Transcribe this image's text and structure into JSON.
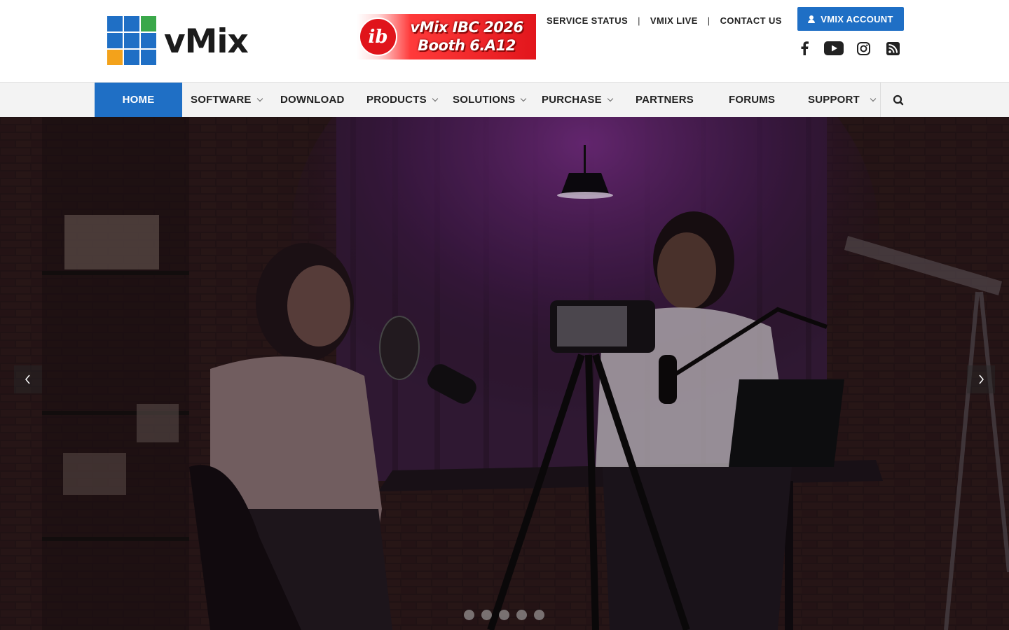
{
  "brand": {
    "name": "vMix",
    "logo_colors": [
      "#1f6fc5",
      "#1f6fc5",
      "#3aa84a",
      "#1f6fc5",
      "#1f6fc5",
      "#1f6fc5",
      "#f3a21b",
      "#1f6fc5",
      "#1f6fc5"
    ]
  },
  "promo": {
    "badge_icon": "ibc-logo",
    "line1": "vMix IBC 2026",
    "line2": "Booth 6.A12"
  },
  "top_links": [
    {
      "label": "SERVICE STATUS"
    },
    {
      "label": "VMIX LIVE"
    },
    {
      "label": "CONTACT US"
    }
  ],
  "top_link_separator": "|",
  "account_button": {
    "label": "VMIX ACCOUNT",
    "icon": "user-icon"
  },
  "social": [
    {
      "name": "facebook-icon"
    },
    {
      "name": "youtube-icon"
    },
    {
      "name": "instagram-icon"
    },
    {
      "name": "rss-icon"
    }
  ],
  "nav": {
    "items": [
      {
        "label": "HOME",
        "active": true,
        "dropdown": false
      },
      {
        "label": "SOFTWARE",
        "active": false,
        "dropdown": true
      },
      {
        "label": "DOWNLOAD",
        "active": false,
        "dropdown": false
      },
      {
        "label": "PRODUCTS",
        "active": false,
        "dropdown": true
      },
      {
        "label": "SOLUTIONS",
        "active": false,
        "dropdown": true
      },
      {
        "label": "PURCHASE",
        "active": false,
        "dropdown": true
      },
      {
        "label": "PARTNERS",
        "active": false,
        "dropdown": false
      },
      {
        "label": "FORUMS",
        "active": false,
        "dropdown": false
      },
      {
        "label": "SUPPORT",
        "active": false,
        "dropdown": true
      }
    ],
    "search_icon": "search-icon"
  },
  "hero": {
    "image_subject": "podcast recording studio",
    "prev_icon": "chevron-left-icon",
    "next_icon": "chevron-right-icon",
    "slide_count": 5,
    "active_slide": 1
  },
  "colors": {
    "accent": "#1f6fc5",
    "nav_bg": "#f3f3f3"
  }
}
